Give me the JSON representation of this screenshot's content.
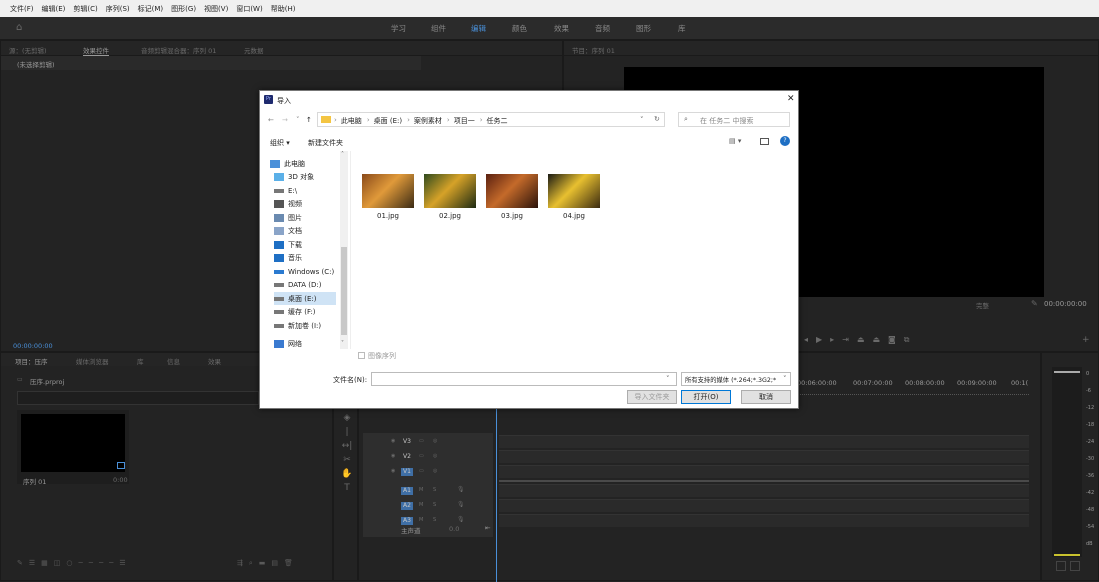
{
  "menu": [
    "文件(F)",
    "编辑(E)",
    "剪辑(C)",
    "序列(S)",
    "标记(M)",
    "图形(G)",
    "视图(V)",
    "窗口(W)",
    "帮助(H)"
  ],
  "workspace_tabs": [
    {
      "label": "学习",
      "active": false
    },
    {
      "label": "组件",
      "active": false
    },
    {
      "label": "编辑",
      "active": true
    },
    {
      "label": "颜色",
      "active": false
    },
    {
      "label": "效果",
      "active": false
    },
    {
      "label": "音频",
      "active": false
    },
    {
      "label": "图形",
      "active": false
    },
    {
      "label": "库",
      "active": false
    }
  ],
  "source_panel": {
    "tabs": [
      "源：(无剪辑)",
      "效果控件",
      "音频剪辑混合器：序列 01",
      "元数据"
    ],
    "no_clip": "(未选择剪辑)",
    "timecode": "00:00:00:00"
  },
  "program_panel": {
    "tab": "节目：序列 01",
    "timecode": "00:00:00:00",
    "fit": "完整"
  },
  "project_panel": {
    "tabs": [
      "项目：压序",
      "媒体浏览器",
      "库",
      "信息",
      "效果"
    ],
    "project_file": "压序.prproj",
    "clip_name": "序列 01",
    "clip_duration": "0:00"
  },
  "timeline": {
    "ruler": [
      "00:06:00:00",
      "00:07:00:00",
      "00:08:00:00",
      "00:09:00:00",
      "00:1("
    ],
    "video_tracks": [
      "V3",
      "V2",
      "V1"
    ],
    "audio_tracks": [
      "A1",
      "A2",
      "A3"
    ],
    "master": "主声道",
    "master_value": "0.0"
  },
  "audio_meter": {
    "labels": [
      "0",
      "-6",
      "-12",
      "-18",
      "-24",
      "-30",
      "-36",
      "-42",
      "-48",
      "-54",
      "dB"
    ]
  },
  "dialog": {
    "title": "导入",
    "address": [
      "此电脑",
      "桌面 (E:)",
      "案例素材",
      "项目一",
      "任务二"
    ],
    "search_placeholder": "在 任务二 中搜索",
    "toolbar": {
      "organize": "组织 ▾",
      "new_folder": "新建文件夹"
    },
    "nav": [
      {
        "label": "此电脑",
        "icon": "computer-icon"
      },
      {
        "label": "3D 对象",
        "icon": "3d-objects-icon"
      },
      {
        "label": "E:\\",
        "icon": "drive-icon"
      },
      {
        "label": "视频",
        "icon": "video-folder-icon"
      },
      {
        "label": "图片",
        "icon": "pictures-folder-icon"
      },
      {
        "label": "文档",
        "icon": "documents-folder-icon"
      },
      {
        "label": "下载",
        "icon": "downloads-folder-icon"
      },
      {
        "label": "音乐",
        "icon": "music-folder-icon"
      },
      {
        "label": "Windows (C:)",
        "icon": "windows-drive-icon"
      },
      {
        "label": "DATA (D:)",
        "icon": "drive-icon"
      },
      {
        "label": "桌面 (E:)",
        "icon": "drive-icon",
        "selected": true
      },
      {
        "label": "缓存 (F:)",
        "icon": "drive-icon"
      },
      {
        "label": "新加卷 (I:)",
        "icon": "drive-icon"
      },
      {
        "label": "网络",
        "icon": "network-icon"
      }
    ],
    "files": [
      {
        "name": "01.jpg",
        "colors": [
          "#8a4a1a",
          "#e09a3a",
          "#3a2a14"
        ]
      },
      {
        "name": "02.jpg",
        "colors": [
          "#2e4a1e",
          "#d6a228",
          "#1c2a12"
        ]
      },
      {
        "name": "03.jpg",
        "colors": [
          "#5a2010",
          "#c46a2a",
          "#2a120a"
        ]
      },
      {
        "name": "04.jpg",
        "colors": [
          "#1a1a14",
          "#e8c030",
          "#3a2a10"
        ]
      }
    ],
    "image_sequence": "图像序列",
    "filename_label": "文件名(N):",
    "filename_value": "",
    "filter": "所有支持的媒体 (*.264;*.3G2;*",
    "buttons": {
      "import_folder": "导入文件夹",
      "open": "打开(O)",
      "cancel": "取消"
    }
  }
}
